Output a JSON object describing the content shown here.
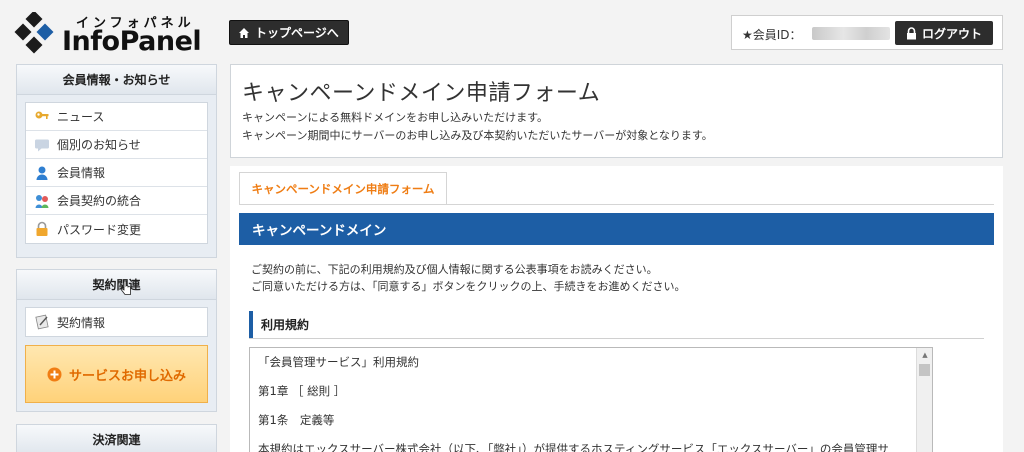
{
  "header": {
    "logo_kana": "インフォパネル",
    "logo_word": "InfoPanel",
    "top_page_button": "トップページへ",
    "member_id_label": "★会員ID：",
    "logout_button": "ログアウト"
  },
  "sidebar": {
    "member_section": {
      "title": "会員情報・お知らせ",
      "items": [
        {
          "label": "ニュース",
          "icon": "key-icon"
        },
        {
          "label": "個別のお知らせ",
          "icon": "message-icon"
        },
        {
          "label": "会員情報",
          "icon": "user-icon"
        },
        {
          "label": "会員契約の統合",
          "icon": "merge-icon"
        },
        {
          "label": "パスワード変更",
          "icon": "lock-icon"
        }
      ]
    },
    "contract_section": {
      "title": "契約関連",
      "items": [
        {
          "label": "契約情報",
          "icon": "document-icon"
        }
      ],
      "service_button": "サービスお申し込み"
    },
    "payment_section": {
      "title": "決済関連"
    }
  },
  "main": {
    "title": "キャンペーンドメイン申請フォーム",
    "description_line1": "キャンペーンによる無料ドメインをお申し込みいただけます。",
    "description_line2": "キャンペーン期間中にサーバーのお申し込み及び本契約いただいたサーバーが対象となります。",
    "tab_label": "キャンペーンドメイン申請フォーム",
    "section_title": "キャンペーンドメイン",
    "intro_line1": "ご契約の前に、下記の利用規約及び個人情報に関する公表事項をお読みください。",
    "intro_line2": "ご同意いただける方は、「同意する」ボタンをクリックの上、手続きをお進めください。",
    "terms_heading": "利用規約",
    "terms_lines": [
      "「会員管理サービス」利用規約",
      "第1章 ［ 総則 ］",
      "第1条　定義等",
      "本規約はエックスサーバー株式会社（以下、「弊社」）が提供するホスティングサービス「エックスサーバー」の会員管理サ"
    ]
  },
  "colors": {
    "accent_blue": "#1d5ea5",
    "accent_orange": "#ef7d14",
    "dark_button": "#2d2d2d"
  }
}
